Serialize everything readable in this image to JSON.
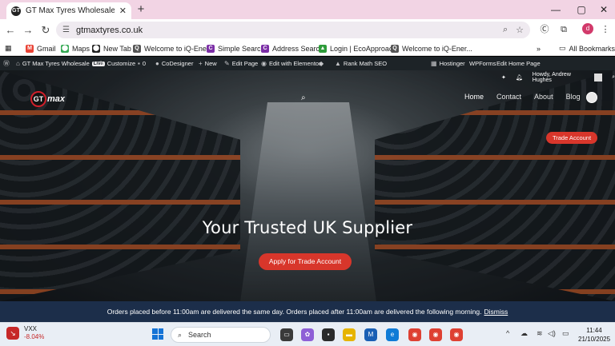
{
  "browser": {
    "tab_title": "GT Max Tyres Wholesale – Qua",
    "tab_favicon": "GT",
    "url": "gtmaxtyres.co.uk",
    "profile_initial": "d"
  },
  "bookmarks": {
    "items": [
      {
        "label": "Gmail",
        "icon": "gmail-icon",
        "color": "#ea4335",
        "glyph": "M"
      },
      {
        "label": "Maps",
        "icon": "maps-icon",
        "color": "#34a853",
        "glyph": "⬤"
      },
      {
        "label": "New Tab",
        "icon": "chrome-icon",
        "color": "#222222",
        "glyph": "⬤"
      },
      {
        "label": "Welcome to iQ-Ener...",
        "icon": "iq-icon",
        "color": "#555555",
        "glyph": "Q"
      },
      {
        "label": "Simple Search",
        "icon": "c-icon",
        "color": "#7b2ea6",
        "glyph": "C"
      },
      {
        "label": "Address Search",
        "icon": "c-icon",
        "color": "#7b2ea6",
        "glyph": "C"
      },
      {
        "label": "Login | EcoApproach",
        "icon": "eco-icon",
        "color": "#2e9b3a",
        "glyph": "▲"
      },
      {
        "label": "Welcome to iQ-Ener...",
        "icon": "iq-icon",
        "color": "#555555",
        "glyph": "Q"
      }
    ],
    "all_bookmarks": "All Bookmarks"
  },
  "wpbar": {
    "site": "GT Max Tyres Wholesale",
    "live": "Live",
    "customize": "Customize",
    "comments": "0",
    "codesigner": "CoDesigner",
    "new": "New",
    "edit_page": "Edit Page",
    "elementor": "Edit with Elementor",
    "rankmath": "Rank Math SEO",
    "hostinger": "Hostinger",
    "wpforms": "WPForms",
    "edit_home": "Edit Home Page",
    "howdy": "Howdy, Andrew Hughes"
  },
  "site": {
    "logo_text": "max",
    "logo_letters": "GT",
    "nav": [
      {
        "label": "Home",
        "active": true
      },
      {
        "label": "Contact",
        "active": false
      },
      {
        "label": "About",
        "active": false
      },
      {
        "label": "Blog",
        "active": false
      }
    ],
    "trade_account": "Trade Account",
    "hero_title": "Your Trusted UK Supplier",
    "apply_button": "Apply for Trade Account",
    "notice": "Orders placed before 11:00am are delivered the same day. Orders placed after 11:00am are delivered the following morning.",
    "dismiss": "Dismiss"
  },
  "taskbar": {
    "stock_name": "VXX",
    "stock_change": "-8.04%",
    "stock_badge": "1",
    "search_label": "Search",
    "time": "11:44",
    "date": "21/10/2025"
  }
}
